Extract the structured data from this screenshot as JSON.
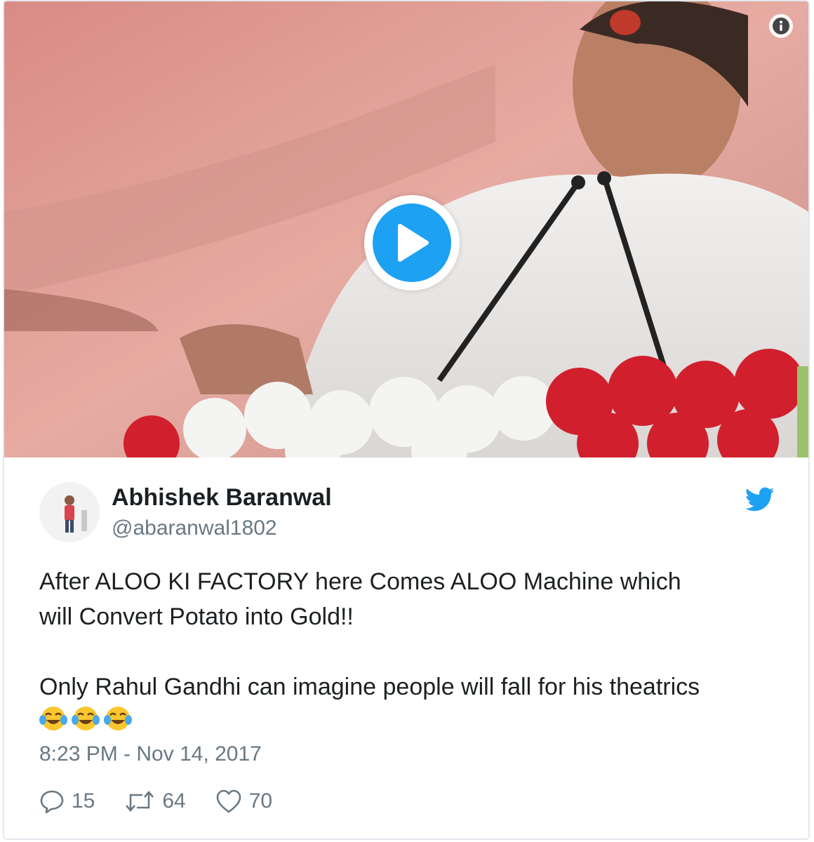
{
  "video": {
    "info_icon": "info-icon",
    "play_icon": "play-icon",
    "accent": "#1da1f2"
  },
  "tweet": {
    "author_name": "Abhishek Baranwal",
    "author_handle": "@abaranwal1802",
    "brand_icon": "twitter-bird-icon",
    "text_line1": "After ALOO KI FACTORY here Comes ALOO Machine which",
    "text_line2": "will Convert Potato into Gold!!",
    "text_line3": "Only Rahul Gandhi can imagine people will fall for his theatrics",
    "emojis": [
      "face-with-tears-of-joy",
      "face-with-tears-of-joy",
      "face-with-tears-of-joy"
    ],
    "timestamp": "8:23 PM - Nov 14, 2017",
    "actions": {
      "reply_count": "15",
      "retweet_count": "64",
      "like_count": "70"
    },
    "muted_color": "#697882"
  }
}
